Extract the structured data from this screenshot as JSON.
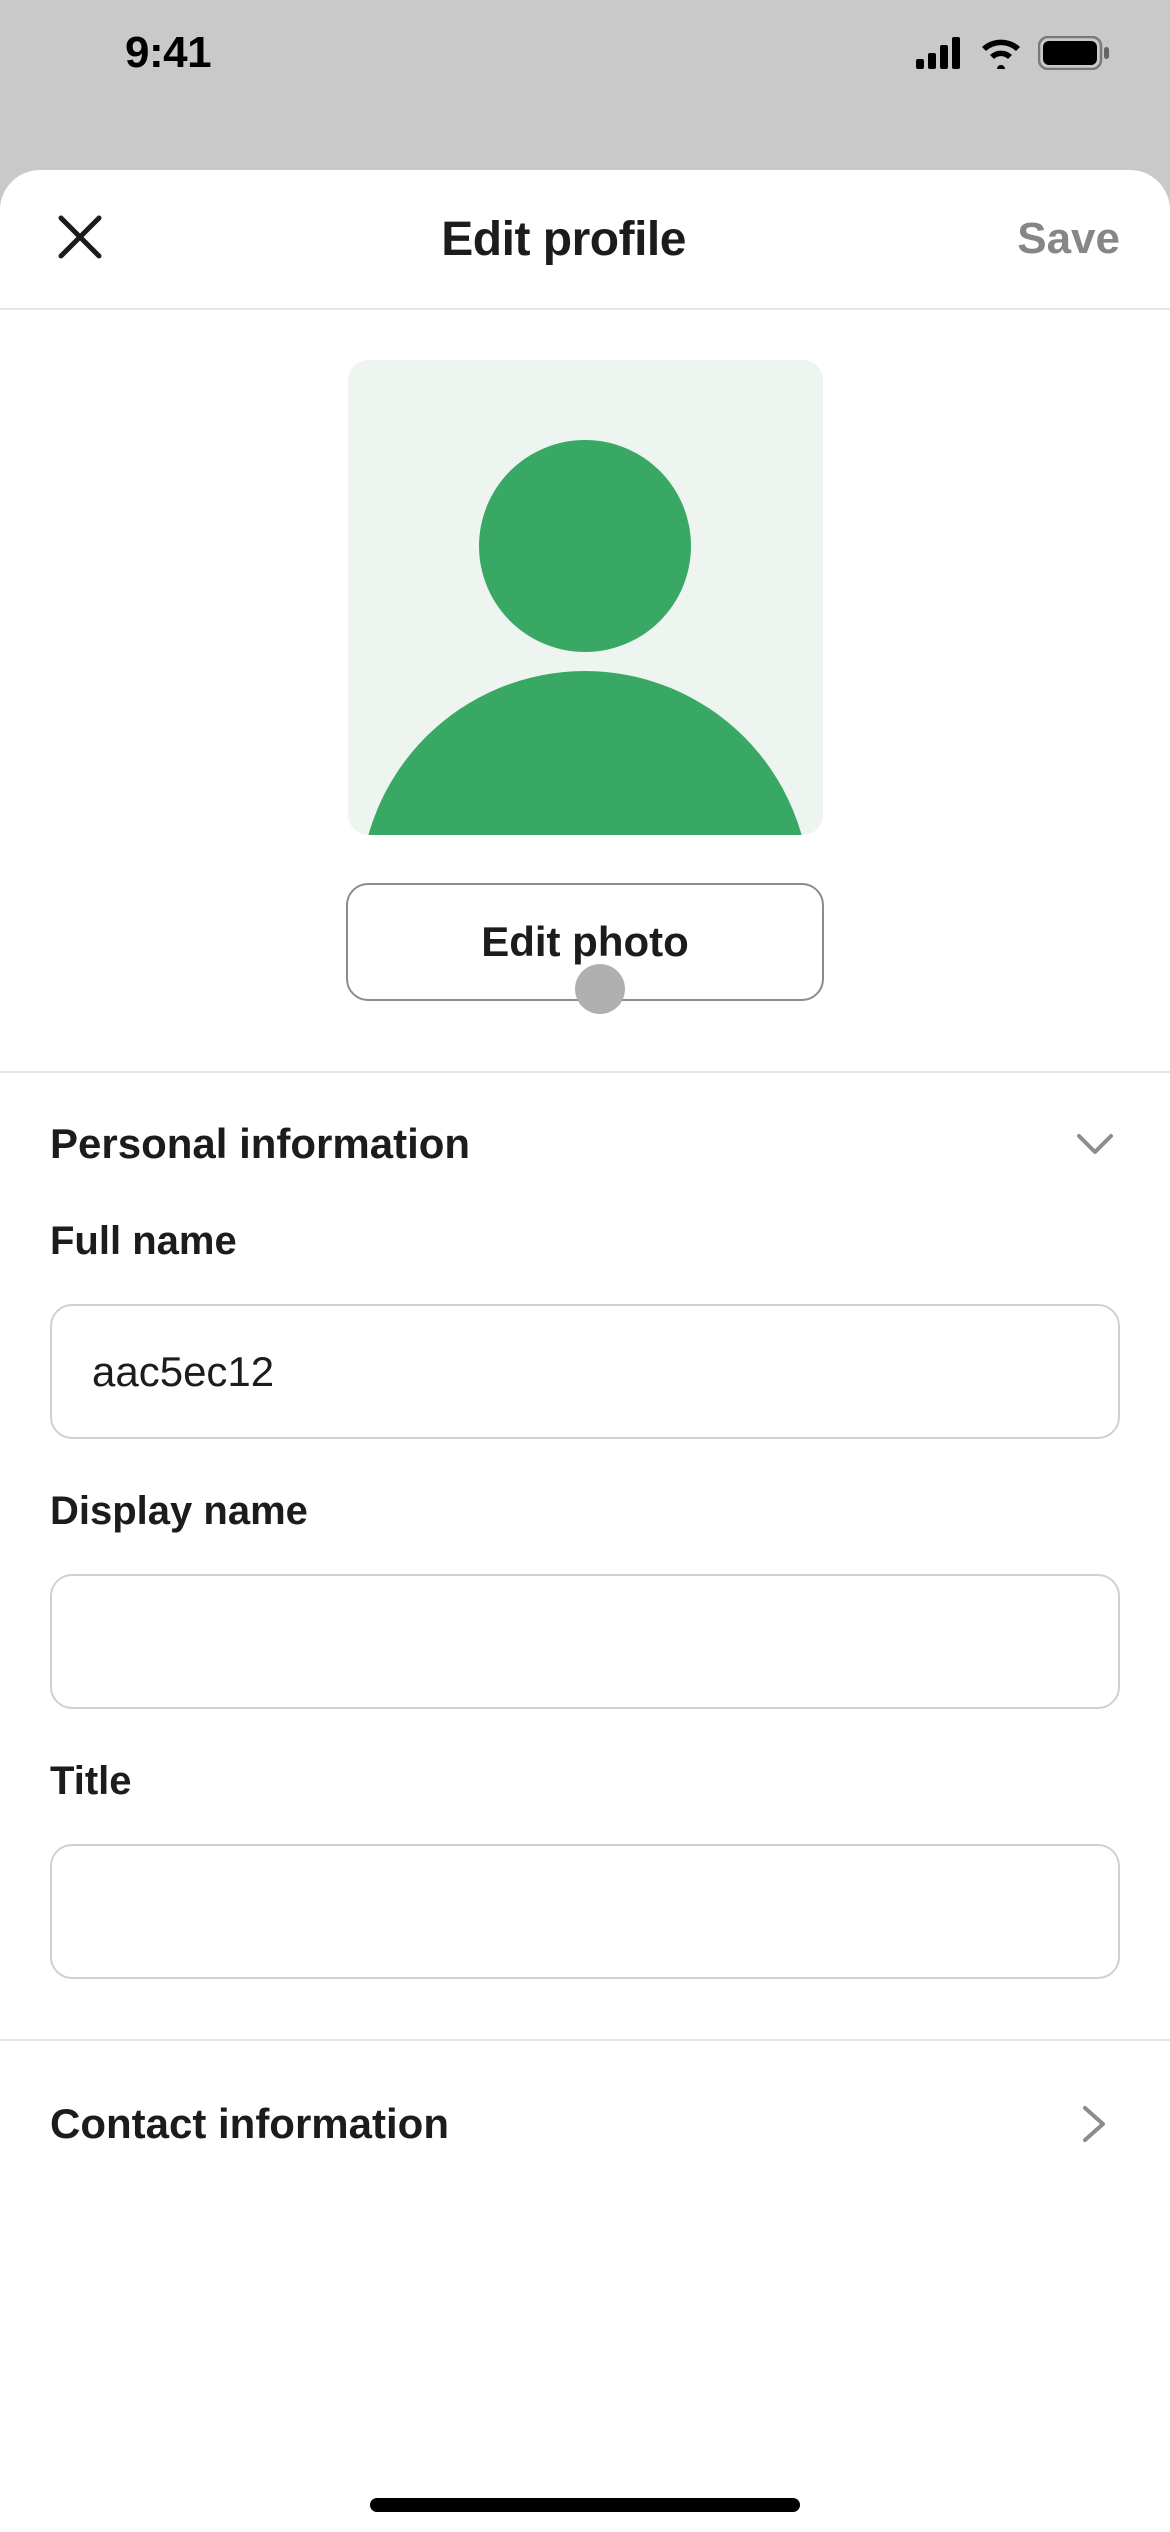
{
  "statusBar": {
    "time": "9:41"
  },
  "header": {
    "title": "Edit profile",
    "save": "Save"
  },
  "photo": {
    "editPhoto": "Edit photo"
  },
  "sections": {
    "personal": {
      "title": "Personal information",
      "fields": {
        "fullName": {
          "label": "Full name",
          "value": "aac5ec12"
        },
        "displayName": {
          "label": "Display name",
          "value": ""
        },
        "title": {
          "label": "Title",
          "value": ""
        }
      }
    },
    "contact": {
      "title": "Contact information"
    }
  }
}
